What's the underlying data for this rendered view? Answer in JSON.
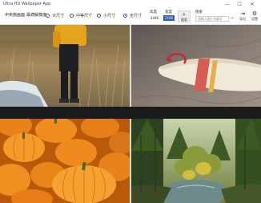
{
  "window": {
    "title": "Ultra HD Wallpaper App",
    "controls": {
      "minimize": "—",
      "maximize": "☐",
      "close": "✕"
    }
  },
  "toolbar": {
    "buttons": [
      "中央揃画面",
      "最適解像度"
    ],
    "size_options": [
      {
        "label": "大尺寸",
        "selected": false
      },
      {
        "label": "中等尺寸",
        "selected": false
      },
      {
        "label": "小尺寸",
        "selected": false
      },
      {
        "label": "全尺寸",
        "selected": true
      }
    ],
    "height_label": "高度",
    "height_value": "4096",
    "width_label": "宽度",
    "width_value": "2160",
    "search_button_label": "搜索",
    "search_label": "搜索",
    "search_placeholder": "请输入图片关键字",
    "export_label": "导出",
    "settings_label": "设置"
  },
  "colors": {
    "accent": "#2d5db8",
    "titlebar": "#ffffff",
    "gap": "#1a1a1a"
  },
  "tiles": [
    {
      "subject": "person-in-yellow-jacket-in-dry-grass"
    },
    {
      "subject": "surfboard-on-sand"
    },
    {
      "subject": "pile-of-pumpkins"
    },
    {
      "subject": "forest-stream"
    }
  ]
}
